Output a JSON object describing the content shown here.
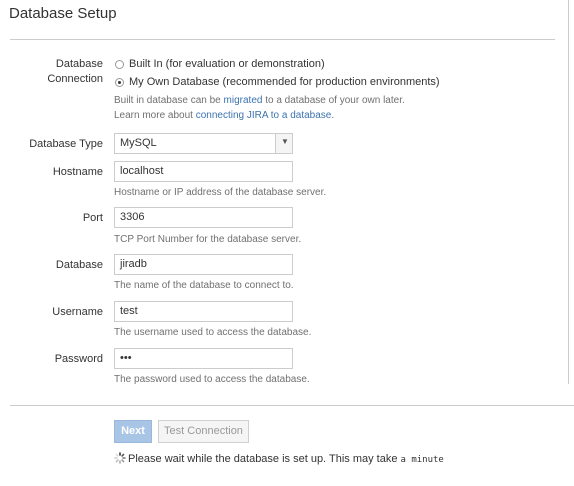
{
  "page": {
    "title": "Database Setup"
  },
  "connection": {
    "label_line1": "Database",
    "label_line2": "Connection",
    "options": [
      {
        "label": "Built In (for evaluation or demonstration)",
        "selected": false
      },
      {
        "label": "My Own Database (recommended for production environments)",
        "selected": true
      }
    ],
    "help1_prefix": "Built in database can be ",
    "help1_link": "migrated",
    "help1_suffix": " to a database of your own later.",
    "help2_prefix": "Learn more about ",
    "help2_link": "connecting JIRA to a database",
    "help2_suffix": "."
  },
  "db_type": {
    "label": "Database Type",
    "value": "MySQL"
  },
  "hostname": {
    "label": "Hostname",
    "value": "localhost",
    "help": "Hostname or IP address of the database server."
  },
  "port": {
    "label": "Port",
    "value": "3306",
    "help": "TCP Port Number for the database server."
  },
  "database": {
    "label": "Database",
    "value": "jiradb",
    "help": "The name of the database to connect to."
  },
  "username": {
    "label": "Username",
    "value": "test",
    "help": "The username used to access the database."
  },
  "password": {
    "label": "Password",
    "value": "•••",
    "help": "The password used to access the database."
  },
  "actions": {
    "next_label": "Next",
    "test_label": "Test Connection"
  },
  "status": {
    "message_main": "Please wait while the database is set up. This may take ",
    "message_mono": "a minute"
  }
}
